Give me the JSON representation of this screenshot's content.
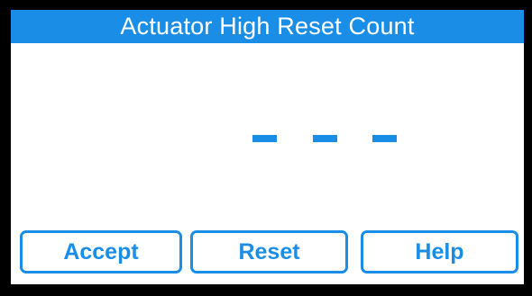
{
  "screen": {
    "title": "Actuator High Reset Count",
    "value_display": "- - -"
  },
  "buttons": {
    "accept_label": "Accept",
    "reset_label": "Reset",
    "help_label": "Help"
  },
  "colors": {
    "accent": "#1a8ee6",
    "background": "#ffffff",
    "bezel": "#000000"
  }
}
